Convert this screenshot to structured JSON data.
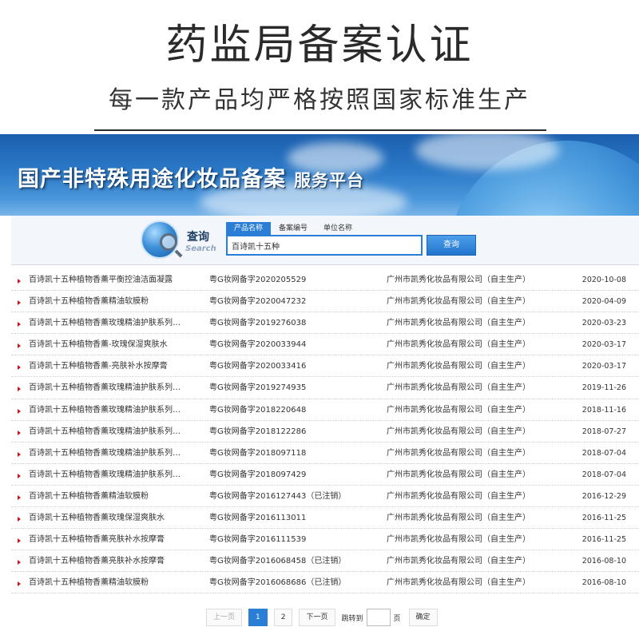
{
  "promo": {
    "title": "药监局备案认证",
    "subtitle": "每一款产品均严格按照国家标准生产"
  },
  "banner": {
    "title": "国产非特殊用途化妆品备案",
    "subtitle": "服务平台"
  },
  "search": {
    "logo_cn": "查询",
    "logo_en": "Search",
    "tabs": [
      "产品名称",
      "备案编号",
      "单位名称"
    ],
    "active_tab": 0,
    "query": "百诗凯十五种",
    "button_label": "查询"
  },
  "results": [
    {
      "name": "百诗凯十五种植物香薰平衡控油洁面凝露",
      "reg": "粤G妆网备字2020205529",
      "company": "广州市凯秀化妆品有限公司（自主生产）",
      "date": "2020-10-08"
    },
    {
      "name": "百诗凯十五种植物香薰精油软膜粉",
      "reg": "粤G妆网备字2020047232",
      "company": "广州市凯秀化妆品有限公司（自主生产）",
      "date": "2020-04-09"
    },
    {
      "name": "百诗凯十五种植物香薰玫瑰精油护肤系列…",
      "reg": "粤G妆网备字2019276038",
      "company": "广州市凯秀化妆品有限公司（自主生产）",
      "date": "2020-03-23"
    },
    {
      "name": "百诗凯十五种植物香薰-玫瑰保湿爽肤水",
      "reg": "粤G妆网备字2020033944",
      "company": "广州市凯秀化妆品有限公司（自主生产）",
      "date": "2020-03-17"
    },
    {
      "name": "百诗凯十五种植物香薰-亮肤补水按摩膏",
      "reg": "粤G妆网备字2020033416",
      "company": "广州市凯秀化妆品有限公司（自主生产）",
      "date": "2020-03-17"
    },
    {
      "name": "百诗凯十五种植物香薰玫瑰精油护肤系列…",
      "reg": "粤G妆网备字2019274935",
      "company": "广州市凯秀化妆品有限公司（自主生产）",
      "date": "2019-11-26"
    },
    {
      "name": "百诗凯十五种植物香薰玫瑰精油护肤系列…",
      "reg": "粤G妆网备字2018220648",
      "company": "广州市凯秀化妆品有限公司（自主生产）",
      "date": "2018-11-16"
    },
    {
      "name": "百诗凯十五种植物香薰玫瑰精油护肤系列…",
      "reg": "粤G妆网备字2018122286",
      "company": "广州市凯秀化妆品有限公司（自主生产）",
      "date": "2018-07-27"
    },
    {
      "name": "百诗凯十五种植物香薰玫瑰精油护肤系列…",
      "reg": "粤G妆网备字2018097118",
      "company": "广州市凯秀化妆品有限公司（自主生产）",
      "date": "2018-07-04"
    },
    {
      "name": "百诗凯十五种植物香薰玫瑰精油护肤系列…",
      "reg": "粤G妆网备字2018097429",
      "company": "广州市凯秀化妆品有限公司（自主生产）",
      "date": "2018-07-04"
    },
    {
      "name": "百诗凯十五种植物香薰精油软膜粉",
      "reg": "粤G妆网备字2016127443（已注销）",
      "company": "广州市凯秀化妆品有限公司（自主生产）",
      "date": "2016-12-29"
    },
    {
      "name": "百诗凯十五种植物香薰玫瑰保湿爽肤水",
      "reg": "粤G妆网备字2016113011",
      "company": "广州市凯秀化妆品有限公司（自主生产）",
      "date": "2016-11-25"
    },
    {
      "name": "百诗凯十五种植物香薰亮肤补水按摩膏",
      "reg": "粤G妆网备字2016111539",
      "company": "广州市凯秀化妆品有限公司（自主生产）",
      "date": "2016-11-25"
    },
    {
      "name": "百诗凯十五种植物香薰亮肤补水按摩膏",
      "reg": "粤G妆网备字2016068458（已注销）",
      "company": "广州市凯秀化妆品有限公司（自主生产）",
      "date": "2016-08-10"
    },
    {
      "name": "百诗凯十五种植物香薰精油软膜粉",
      "reg": "粤G妆网备字2016068686（已注销）",
      "company": "广州市凯秀化妆品有限公司（自主生产）",
      "date": "2016-08-10"
    }
  ],
  "pager": {
    "prev": "上一页",
    "pages": [
      "1",
      "2"
    ],
    "current": "1",
    "next": "下一页",
    "jump_label": "跳转到",
    "page_unit": "页",
    "confirm": "确定"
  },
  "colors": {
    "accent": "#2a7ed6",
    "bullet": "#c4161c",
    "banner_dark": "#1b5fae"
  },
  "icons": [
    "search-globe-icon",
    "magnifier-icon",
    "bullet-arrow-icon"
  ]
}
